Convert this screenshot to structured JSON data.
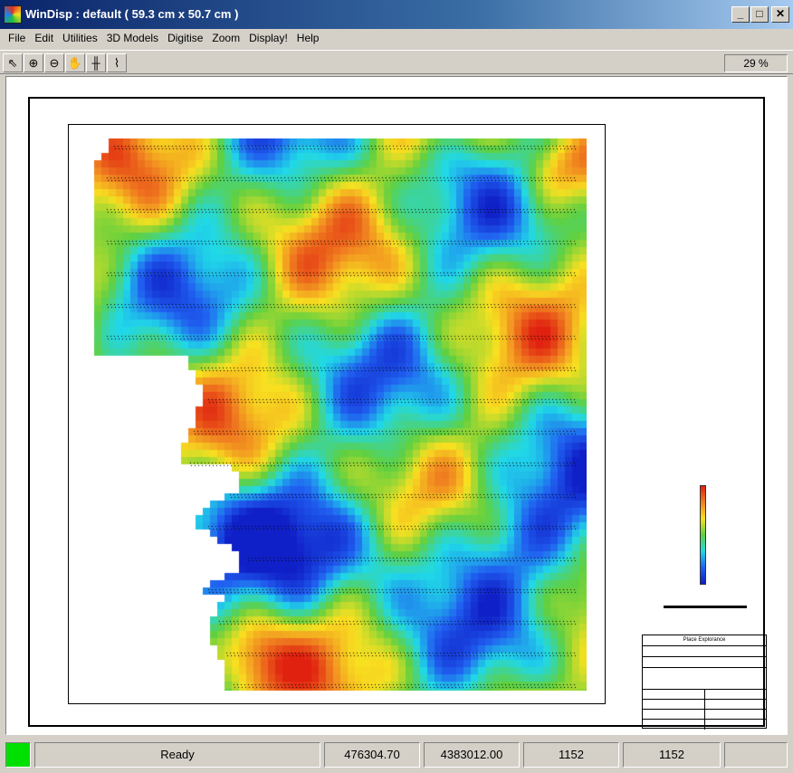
{
  "window": {
    "title": "WinDisp : default ( 59.3 cm x 50.7 cm )"
  },
  "menu": [
    "File",
    "Edit",
    "Utilities",
    "3D Models",
    "Digitise",
    "Zoom",
    "Display!",
    "Help"
  ],
  "toolbar": {
    "tools": [
      {
        "name": "pointer-tool",
        "icon": "arrow-cursor-icon",
        "glyph": "⇖"
      },
      {
        "name": "zoom-in-tool",
        "icon": "zoom-in-icon",
        "glyph": "⊕"
      },
      {
        "name": "zoom-out-tool",
        "icon": "zoom-out-icon",
        "glyph": "⊖"
      },
      {
        "name": "pan-tool",
        "icon": "hand-icon",
        "glyph": "✋"
      },
      {
        "name": "grid-tool",
        "icon": "grid-icon",
        "glyph": "╫"
      },
      {
        "name": "profile-tool",
        "icon": "profile-icon",
        "glyph": "⌇"
      }
    ],
    "zoom": "29 %"
  },
  "status": {
    "state": "Ready",
    "x": "476304.70",
    "y": "4383012.00",
    "col": "1152",
    "row": "1152"
  },
  "titleblock": {
    "title": "Place Explorance"
  },
  "colors": {
    "window_bg": "#d4d0c8",
    "status_led": "#00e000"
  }
}
